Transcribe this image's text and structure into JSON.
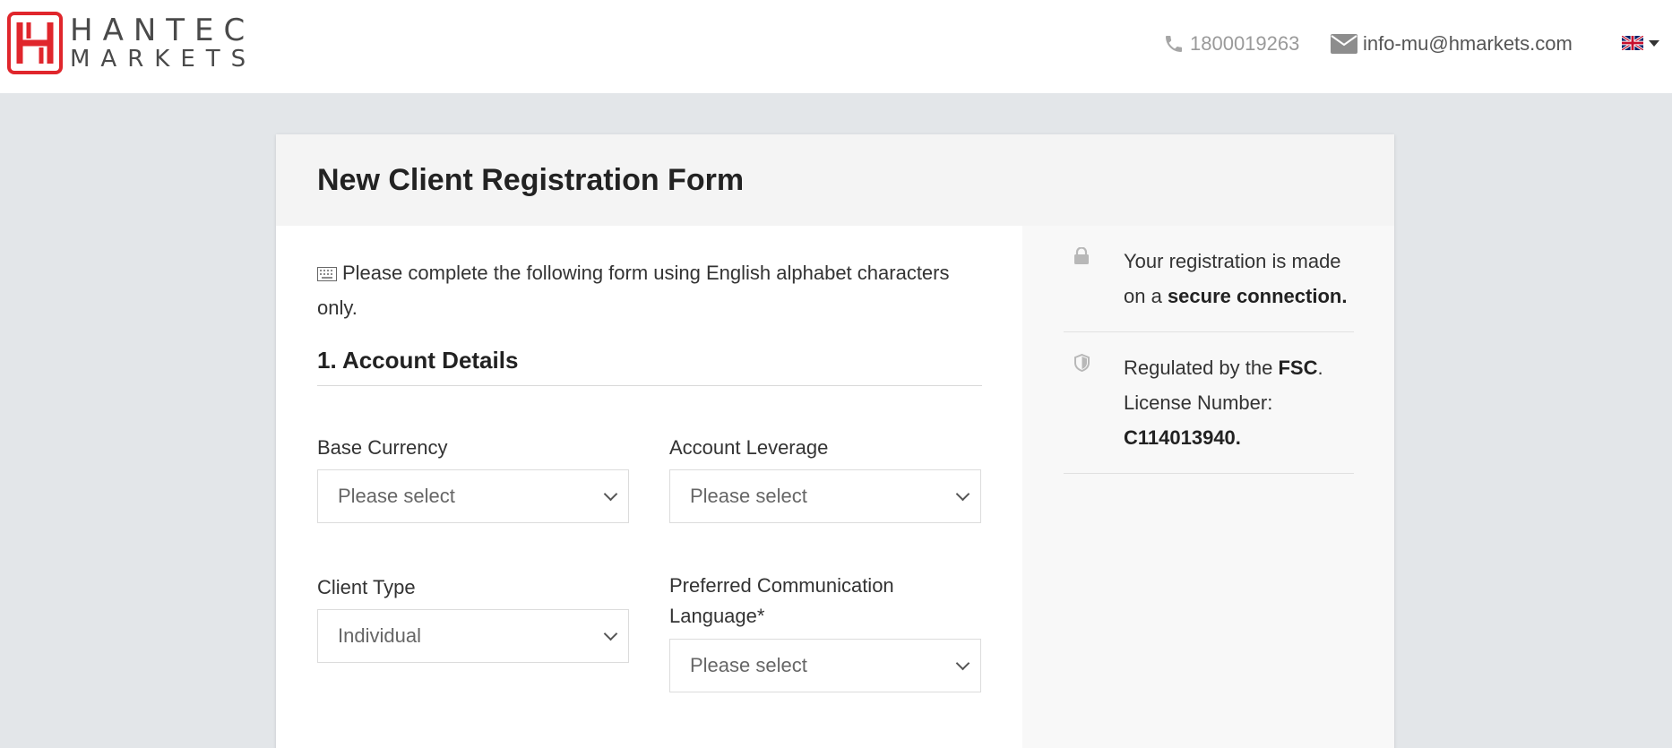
{
  "brand": {
    "line1": "HANTEC",
    "line2": "MARKETS",
    "accent_color": "#e0262c"
  },
  "header": {
    "phone": "1800019263",
    "email": "info-mu@hmarkets.com",
    "language_icon": "uk-flag-icon"
  },
  "form": {
    "title": "New Client Registration Form",
    "intro": "Please complete the following form using English alphabet characters only.",
    "section1_title": "1. Account Details",
    "fields": {
      "base_currency": {
        "label": "Base Currency",
        "value": "Please select"
      },
      "account_leverage": {
        "label": "Account Leverage",
        "value": "Please select"
      },
      "client_type": {
        "label": "Client Type",
        "value": "Individual"
      },
      "preferred_language": {
        "label": "Preferred Communication Language*",
        "value": "Please select"
      }
    }
  },
  "sidebar": {
    "secure": {
      "text_before": "Your registration is made on a ",
      "bold": "secure connection."
    },
    "regulated": {
      "text_before": "Regulated by the ",
      "bold": "FSC",
      "text_after": ". License Number: ",
      "license": "C114013940."
    }
  }
}
